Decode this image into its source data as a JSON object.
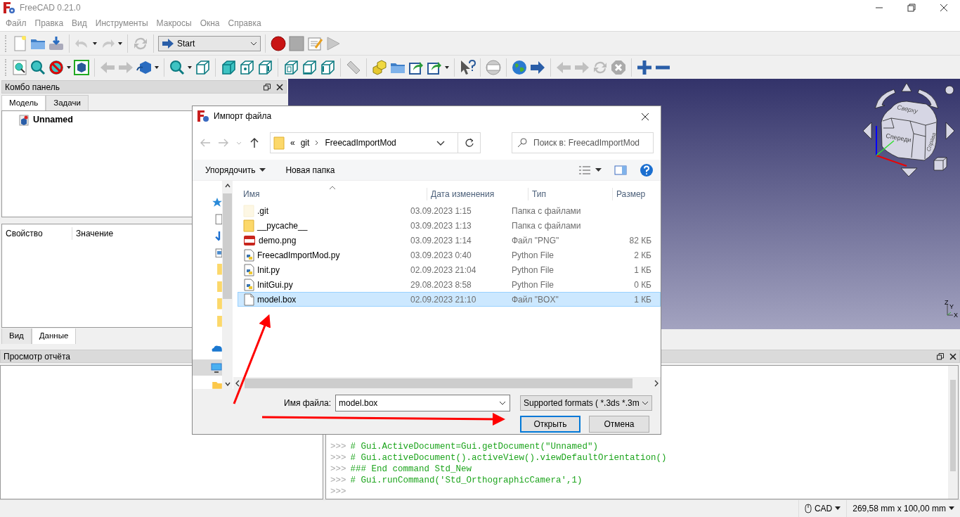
{
  "window": {
    "title": "FreeCAD 0.21.0"
  },
  "menu": [
    "Файл",
    "Правка",
    "Вид",
    "Инструменты",
    "Макросы",
    "Окна",
    "Справка"
  ],
  "workbench": {
    "value": "Start"
  },
  "combo_panel": {
    "title": "Комбо панель",
    "tabs": [
      {
        "label": "Модель",
        "selected": true
      },
      {
        "label": "Задачи",
        "selected": false
      }
    ],
    "tree": [
      {
        "label": "Unnamed"
      }
    ],
    "property_columns": [
      "Свойство",
      "Значение"
    ],
    "bottom_tabs": [
      {
        "label": "Вид",
        "selected": false
      },
      {
        "label": "Данные",
        "selected": true
      }
    ]
  },
  "navigation_cube": {
    "faces": [
      "Сверху",
      "Спереди",
      "Справа"
    ],
    "axis_labels": [
      "Z",
      "Y",
      "X"
    ]
  },
  "report_view": {
    "title": "Просмотр отчёта"
  },
  "python_console": {
    "lines": [
      {
        "prompt": ">>>",
        "code": "# Gui.ActiveDocument=Gui.getDocument(\"Unnamed\")"
      },
      {
        "prompt": ">>>",
        "code": "# Gui.activeDocument().activeView().viewDefaultOrientation()"
      },
      {
        "prompt": ">>>",
        "code": "### End command Std_New"
      },
      {
        "prompt": ">>>",
        "code": "# Gui.runCommand('Std_OrthographicCamera',1)"
      },
      {
        "prompt": ">>>"
      }
    ]
  },
  "dialog": {
    "title": "Импорт файла",
    "path_overflow": "«",
    "path": [
      "git",
      "FreecadImportMod"
    ],
    "search": {
      "placeholder": "Поиск в: FreecadImportMod"
    },
    "commands": [
      "Упорядочить",
      "Новая папка"
    ],
    "columns": [
      "Имя",
      "Дата изменения",
      "Тип",
      "Размер"
    ],
    "files": [
      {
        "kind": "folder",
        "hidden": true,
        "name": ".git",
        "date": "03.09.2023 1:15",
        "type": "Папка с файлами",
        "selected": false
      },
      {
        "kind": "folder",
        "hidden": false,
        "name": "__pycache__",
        "date": "03.09.2023 1:13",
        "type": "Папка с файлами",
        "selected": false
      },
      {
        "kind": "png",
        "hidden": false,
        "name": "demo.png",
        "date": "03.09.2023 1:14",
        "type": "Файл \"PNG\"",
        "size": "82 КБ",
        "selected": false
      },
      {
        "kind": "python",
        "hidden": false,
        "name": "FreecadImportMod.py",
        "date": "03.09.2023 0:40",
        "type": "Python File",
        "size": "2 КБ",
        "selected": false
      },
      {
        "kind": "python",
        "hidden": false,
        "name": "Init.py",
        "date": "02.09.2023 21:04",
        "type": "Python File",
        "size": "1 КБ",
        "selected": false
      },
      {
        "kind": "python",
        "hidden": false,
        "name": "InitGui.py",
        "date": "29.08.2023 8:58",
        "type": "Python File",
        "size": "0 КБ",
        "selected": false
      },
      {
        "kind": "file",
        "hidden": false,
        "name": "model.box",
        "date": "02.09.2023 21:10",
        "type": "Файл \"BOX\"",
        "size": "1 КБ",
        "selected": true
      }
    ],
    "file_name": {
      "label": "Имя файла:",
      "value": "model.box"
    },
    "filter": {
      "value": "Supported formats ( *.3ds *.3m"
    },
    "buttons": [
      {
        "label": "Открыть",
        "default": true
      },
      {
        "label": "Отмена",
        "default": false
      }
    ]
  },
  "status_bar": {
    "navigation_style": "CAD",
    "dimensions": "269,58 mm x 100,00 mm"
  }
}
